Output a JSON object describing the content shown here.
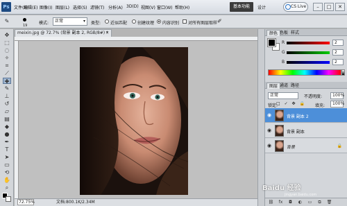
{
  "app": {
    "logo_text": "Ps",
    "menus": [
      "文件(F)",
      "编辑(E)",
      "图像(I)",
      "图层(L)",
      "选择(S)",
      "滤镜(T)",
      "分析(A)",
      "3D(D)",
      "视图(V)",
      "窗口(W)",
      "帮助(H)"
    ],
    "zoom_display": "72.7",
    "workspace": "基本功能",
    "design": "设计",
    "cslive": "CS Live",
    "window_buttons": [
      "–",
      "□",
      "✕"
    ]
  },
  "options_bar": {
    "brush_size": "19",
    "mode_label": "模式:",
    "mode_value": "正常",
    "type_label": "类型:",
    "type_options": [
      "近似匹配",
      "创建纹理",
      "内容识别"
    ],
    "sample_all_label": "对所有图层取样"
  },
  "document": {
    "tab_title": "meixin.jpg @ 72.7% (背景 副本 2, RGB/8#) *",
    "close": "×",
    "status_zoom": "72.75%",
    "status_doc": "文档:800.1K/2.34M"
  },
  "color_panel": {
    "tabs": [
      "颜色",
      "色板",
      "样式"
    ],
    "sliders": [
      {
        "label": "R",
        "value": "2",
        "color": "#d42a2a"
      },
      {
        "label": "G",
        "value": "2",
        "color": "#2aa43a"
      },
      {
        "label": "B",
        "value": "2",
        "color": "#2a4ad4"
      }
    ]
  },
  "layers_panel": {
    "tabs": [
      "图层",
      "通道",
      "路径"
    ],
    "blend_mode": "正常",
    "opacity_label": "不透明度:",
    "opacity_value": "100%",
    "lock_label": "锁定:",
    "lock_icons": "□ ✓ ✥ 🔒",
    "fill_label": "填充:",
    "fill_value": "100%",
    "layers": [
      {
        "name": "背景 副本 2",
        "selected": true
      },
      {
        "name": "背景 副本",
        "selected": false
      },
      {
        "name": "背景",
        "selected": false,
        "locked": true
      }
    ],
    "footer_icons": [
      "link-icon",
      "fx-icon",
      "mask-icon",
      "adjustment-icon",
      "group-icon",
      "new-layer-icon",
      "trash-icon"
    ]
  },
  "watermark": {
    "text": "Baidu 经验",
    "sub": "jingyan.baidu.com"
  },
  "colors": {
    "selected_layer": "#4d8fd9",
    "workspace_btn": "#3b3b3b"
  }
}
